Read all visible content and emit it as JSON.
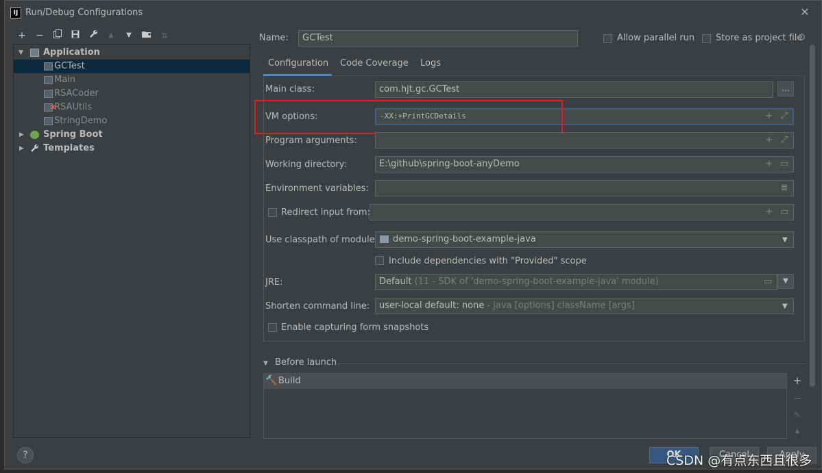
{
  "window": {
    "title": "Run/Debug Configurations",
    "app_icon": "IJ"
  },
  "toolbar": {
    "add": "+",
    "remove": "−",
    "copy": "⧉",
    "save": "💾",
    "edit": "🔧",
    "up": "▲",
    "down": "▼",
    "folder": "📁",
    "sort": "⇅"
  },
  "tree": {
    "application": "Application",
    "items": [
      "GCTest",
      "Main",
      "RSACoder",
      "RSAUtils",
      "StringDemo"
    ],
    "spring_boot": "Spring Boot",
    "templates": "Templates"
  },
  "header": {
    "name_label": "Name:",
    "name_value": "GCTest",
    "allow_parallel_label": "Allow parallel run",
    "store_label": "Store as project file"
  },
  "tabs": [
    "Configuration",
    "Code Coverage",
    "Logs"
  ],
  "form": {
    "main_class_label": "Main class:",
    "main_class_value": "com.hjt.gc.GCTest",
    "browse": "...",
    "vm_options_label": "VM options:",
    "vm_options_value": "-XX:+PrintGCDetails",
    "program_args_label": "Program arguments:",
    "program_args_value": "",
    "working_dir_label": "Working directory:",
    "working_dir_value": "E:\\github\\spring-boot-anyDemo",
    "env_vars_label": "Environment variables:",
    "env_vars_value": "",
    "redirect_label": "Redirect input from:",
    "classpath_label": "Use classpath of module:",
    "classpath_value": "demo-spring-boot-example-java",
    "include_deps_label": "Include dependencies with \"Provided\" scope",
    "jre_label": "JRE:",
    "jre_value": "Default",
    "jre_hint": "(11 - SDK of 'demo-spring-boot-example-java' module)",
    "shorten_label": "Shorten command line:",
    "shorten_value": "user-local default: none",
    "shorten_hint": "- java [options] className [args]",
    "snapshots_label": "Enable capturing form snapshots"
  },
  "before_launch": {
    "header": "Before launch",
    "items": [
      "Build"
    ]
  },
  "footer": {
    "help": "?",
    "ok": "OK",
    "cancel": "Cancel",
    "apply": "Apply",
    "watermark": "CSDN @有点东西且很多"
  }
}
